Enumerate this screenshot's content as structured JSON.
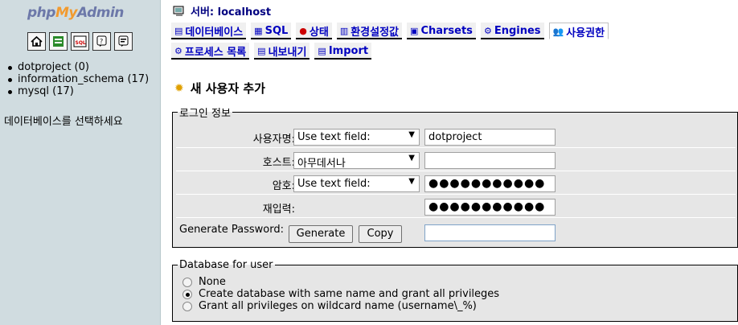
{
  "left": {
    "logo": {
      "php": "php",
      "my": "My",
      "admin": "Admin"
    },
    "icons": [
      "home-icon",
      "query-window-icon",
      "sql-icon",
      "docs-icon",
      "help-icon"
    ],
    "databases": [
      "dotproject (0)",
      "information_schema (17)",
      "mysql (17)"
    ],
    "hint": "데이터베이스를 선택하세요"
  },
  "header": {
    "server_label": "서버: localhost"
  },
  "tabs_row1": [
    {
      "label": "데이터베이스",
      "icon": "database-icon"
    },
    {
      "label": "SQL",
      "icon": "sql-icon"
    },
    {
      "label": "상태",
      "icon": "status-icon"
    },
    {
      "label": "환경설정값",
      "icon": "variables-icon"
    },
    {
      "label": "Charsets",
      "icon": "charsets-icon"
    },
    {
      "label": "Engines",
      "icon": "engines-icon"
    },
    {
      "label": "사용권한",
      "icon": "privileges-icon"
    }
  ],
  "tabs_row2": [
    {
      "label": "프로세스 목록",
      "icon": "processes-icon"
    },
    {
      "label": "내보내기",
      "icon": "export-icon"
    },
    {
      "label": "Import",
      "icon": "import-icon"
    }
  ],
  "page_title": "새 사용자 추가",
  "login": {
    "legend": "로그인 정보",
    "username_label": "사용자명:",
    "username_mode": "Use text field:",
    "username_value": "dotproject",
    "host_label": "호스트:",
    "host_mode": "아무데서나",
    "host_value": "",
    "password_label": "암호:",
    "password_mode": "Use text field:",
    "password_value": "●●●●●●●●●●●",
    "reenter_label": "재입력:",
    "reenter_value": "●●●●●●●●●●●",
    "generate_label": "Generate Password:",
    "generate_button": "Generate",
    "copy_button": "Copy",
    "generated_value": ""
  },
  "dbuser": {
    "legend": "Database for user",
    "options": [
      {
        "label": "None",
        "checked": false
      },
      {
        "label": "Create database with same name and grant all privileges",
        "checked": true
      },
      {
        "label": "Grant all privileges on wildcard name (username\\_%)",
        "checked": false
      }
    ]
  }
}
